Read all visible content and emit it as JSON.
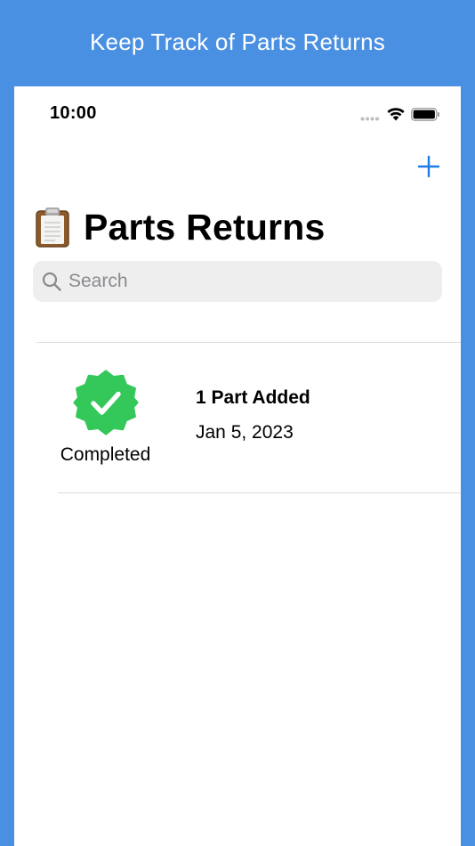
{
  "banner": {
    "text": "Keep Track of Parts Returns"
  },
  "status_bar": {
    "time": "10:00",
    "icons": [
      "signal-dots-icon",
      "wifi-icon",
      "battery-icon"
    ]
  },
  "nav": {
    "add_icon": "plus-icon"
  },
  "header": {
    "emoji_icon": "clipboard-icon",
    "title": "Parts Returns"
  },
  "search": {
    "placeholder": "Search",
    "value": ""
  },
  "returns": [
    {
      "status": "Completed",
      "status_icon": "check-badge-icon",
      "title": "1 Part Added",
      "date": "Jan 5, 2023"
    }
  ],
  "colors": {
    "background": "#4A90E2",
    "accent": "#1E7CE6",
    "completed": "#34C759",
    "search_bg": "#EEEEEF"
  }
}
